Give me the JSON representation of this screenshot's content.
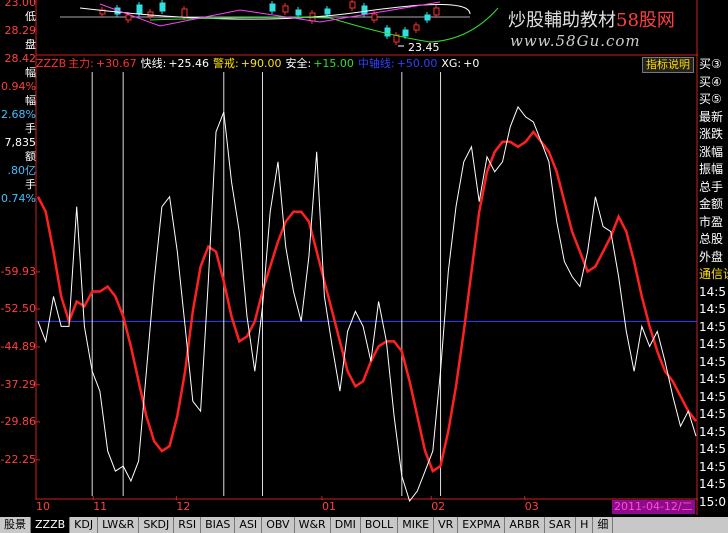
{
  "left_panel": [
    {
      "text": "23.00",
      "color": "#ff4040"
    },
    {
      "text": "低",
      "color": "#ffffff"
    },
    {
      "text": "28.29",
      "color": "#ff4040"
    },
    {
      "text": "盘",
      "color": "#ffffff"
    },
    {
      "text": "28.42",
      "color": "#ff4040"
    },
    {
      "text": "幅",
      "color": "#ffffff"
    },
    {
      "text": "0.94%",
      "color": "#ff4040"
    },
    {
      "text": "幅",
      "color": "#ffffff"
    },
    {
      "text": "2.68%",
      "color": "#40c0ff"
    },
    {
      "text": "手",
      "color": "#ffffff"
    },
    {
      "text": "7,835",
      "color": "#ffffff"
    },
    {
      "text": "额",
      "color": "#ffffff"
    },
    {
      "text": ".80亿",
      "color": "#40c0ff"
    },
    {
      "text": "手",
      "color": "#ffffff"
    },
    {
      "text": "0.74%",
      "color": "#40c0ff"
    }
  ],
  "price_label": "23.45",
  "watermark": {
    "title": "炒股輔助教材",
    "brand": "58股网",
    "url": "www.58Gu.com"
  },
  "header": {
    "name": "ZZZB",
    "items": [
      {
        "label": "主力:",
        "value": "+30.67",
        "label_color": "#ff3030",
        "value_color": "#ff3030"
      },
      {
        "label": "快线:",
        "value": "+25.46",
        "label_color": "#ffffff",
        "value_color": "#ffffff"
      },
      {
        "label": "警戒:",
        "value": "+90.00",
        "label_color": "#ffe000",
        "value_color": "#ffe000"
      },
      {
        "label": "安全:",
        "value": "+15.00",
        "label_color": "#ffffff",
        "value_color": "#30e030"
      },
      {
        "label": "中轴线:",
        "value": "+50.00",
        "label_color": "#3040ff",
        "value_color": "#3040ff"
      },
      {
        "label": "XG:",
        "value": "+0",
        "label_color": "#ffffff",
        "value_color": "#ffffff"
      }
    ],
    "help": "指标说明"
  },
  "right_panel": [
    {
      "text": "买③",
      "color": "#ffffff"
    },
    {
      "text": "买④",
      "color": "#ffffff"
    },
    {
      "text": "买⑤",
      "color": "#ffffff"
    },
    {
      "text": "最新",
      "color": "#ffffff"
    },
    {
      "text": "涨跌",
      "color": "#ffffff"
    },
    {
      "text": "涨幅",
      "color": "#ffffff"
    },
    {
      "text": "振幅",
      "color": "#ffffff"
    },
    {
      "text": "总手",
      "color": "#ffffff"
    },
    {
      "text": "金额",
      "color": "#ffffff"
    },
    {
      "text": "市盈",
      "color": "#ffffff"
    },
    {
      "text": "总股",
      "color": "#ffffff"
    },
    {
      "text": "外盘",
      "color": "#ffffff"
    },
    {
      "text": "通信设",
      "color": "#ffe000"
    },
    {
      "text": "14:5",
      "color": "#ffffff"
    },
    {
      "text": "14:5",
      "color": "#ffffff"
    },
    {
      "text": "14:5",
      "color": "#ffffff"
    },
    {
      "text": "14:5",
      "color": "#ffffff"
    },
    {
      "text": "14:5",
      "color": "#ffffff"
    },
    {
      "text": "14:5",
      "color": "#ffffff"
    },
    {
      "text": "14:5",
      "color": "#ffffff"
    },
    {
      "text": "14:5",
      "color": "#ffffff"
    },
    {
      "text": "14:5",
      "color": "#ffffff"
    },
    {
      "text": "14:5",
      "color": "#ffffff"
    },
    {
      "text": "14:5",
      "color": "#ffffff"
    },
    {
      "text": "14:5",
      "color": "#ffffff"
    },
    {
      "text": "15:0",
      "color": "#ffffff"
    }
  ],
  "y_labels": [
    "59.93",
    "52.50",
    "44.89",
    "37.29",
    "29.86",
    "22.25"
  ],
  "x_labels": [
    "10",
    "11",
    "12",
    "01",
    "02",
    "03"
  ],
  "date_label": "2011-04-12/二",
  "tabs": [
    "股景",
    "ZZZB",
    "KDJ",
    "LW&R",
    "SKDJ",
    "RSI",
    "BIAS",
    "ASI",
    "OBV",
    "W&R",
    "DMI",
    "BOLL",
    "MIKE",
    "VR",
    "EXPMA",
    "ARBR",
    "SAR",
    "H",
    "细"
  ],
  "active_tab": 1,
  "chart_data": {
    "type": "line",
    "ylim": [
      15,
      100
    ],
    "reference_lines": [
      {
        "name": "中轴线",
        "value": 50,
        "color": "#3040ff"
      }
    ],
    "series": [
      {
        "name": "主力",
        "color": "#ff2020",
        "values": [
          75,
          72,
          64,
          55,
          50,
          54,
          53,
          56,
          56,
          57,
          55,
          51,
          45,
          38,
          31,
          26,
          24,
          25,
          31,
          40,
          52,
          61,
          65,
          64,
          58,
          51,
          46,
          47,
          50,
          56,
          61,
          66,
          70,
          72,
          72,
          70,
          64,
          58,
          52,
          46,
          40,
          37,
          38,
          42,
          45,
          46,
          46,
          44,
          38,
          31,
          24,
          20,
          21,
          28,
          37,
          48,
          60,
          72,
          80,
          84,
          86,
          86,
          85,
          86,
          88,
          86,
          84,
          80,
          74,
          68,
          64,
          60,
          61,
          64,
          67,
          71,
          68,
          62,
          55,
          49,
          44,
          40,
          38,
          35,
          32,
          30
        ]
      },
      {
        "name": "快线",
        "color": "#ffffff",
        "values": [
          50,
          46,
          55,
          49,
          49,
          73,
          49,
          40,
          36,
          24,
          20,
          21,
          18,
          22,
          40,
          58,
          73,
          75,
          64,
          49,
          34,
          32,
          58,
          88,
          92,
          78,
          68,
          51,
          40,
          53,
          72,
          82,
          65,
          56,
          50,
          63,
          84,
          55,
          45,
          36,
          48,
          52,
          49,
          42,
          54,
          46,
          31,
          19,
          14,
          16,
          20,
          24,
          40,
          60,
          73,
          82,
          85,
          74,
          83,
          80,
          82,
          89,
          93,
          91,
          90,
          86,
          82,
          70,
          62,
          59,
          57,
          64,
          75,
          69,
          68,
          59,
          48,
          40,
          49,
          45,
          48,
          42,
          35,
          29,
          32,
          27
        ]
      }
    ],
    "xg_signals": [
      7,
      11,
      24,
      29,
      47,
      52
    ]
  }
}
